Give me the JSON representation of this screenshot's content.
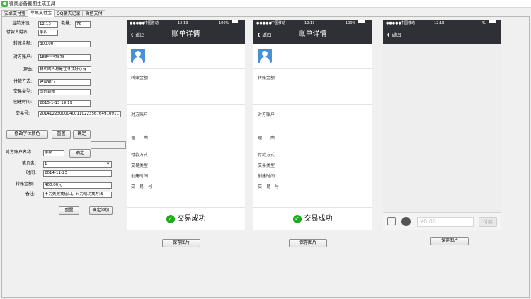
{
  "window": {
    "title": "微商必备截图生成工具"
  },
  "tabs": [
    "安卓支付宝",
    "苹果支付宝",
    "QQ聊天记录",
    "微信支付"
  ],
  "form": {
    "current_time_label": "当前时间:",
    "current_time_value": "12:13",
    "battery_label": "电量:",
    "battery_value": "76",
    "payer_name_label": "付款人姓名",
    "payer_name_value": "李四",
    "amount_label": "转账金额:",
    "amount_value": "300.00",
    "account_label": "对方账户:",
    "account_value": "188****7878",
    "reason_label": "理由:",
    "reason_value": "聪明的人总是在寻找好心有",
    "pay_method_label": "付款方式:",
    "pay_method_value": "建设银行",
    "trade_type_label": "交易类型:",
    "trade_type_value": "即时到帐",
    "created_label": "创建时间:",
    "created_value": "2015-1-13 19:19",
    "trade_no_label": "交易号:",
    "trade_no_value": "20141223000040011022356764910911",
    "font_color_btn": "修改字体颜色",
    "reset_btn": "重置",
    "confirm_btn": "确定"
  },
  "chat_form": {
    "name_label": "对方账户名称",
    "name_value": "李斯",
    "confirm_btn": "确定",
    "index_label": "第几条:",
    "index_value": "1",
    "time_label": "时间:",
    "time_value": "2014-11-23",
    "amount_label": "转账金额:",
    "amount_value": "400.00元",
    "note_label": "备注:",
    "note_value": "不为失败找借口，只为成功找方法",
    "reset_btn": "重置",
    "add_btn": "确定添加"
  },
  "phone": {
    "carrier": "中国移动",
    "time": "12:13",
    "battery_pct": "100%",
    "battery_pct_short": "%",
    "back_label": "返回",
    "title": "账单详情",
    "row_amount": "转账金额",
    "row_account": "对方账户",
    "row_reason": "理　　由",
    "row_pay_method": "付款方式",
    "row_trade_type": "交易类型",
    "row_created": "创建时间",
    "row_trade_no": "交　易　号",
    "success_text": "交易成功",
    "chat_amount_placeholder": "¥0.00",
    "chat_pay_btn": "付款"
  },
  "save_btn": "保存图片",
  "colors": {
    "nav_bg": "#2e3035",
    "success_green": "#1aad19",
    "avatar_blue": "#4a90d9"
  }
}
